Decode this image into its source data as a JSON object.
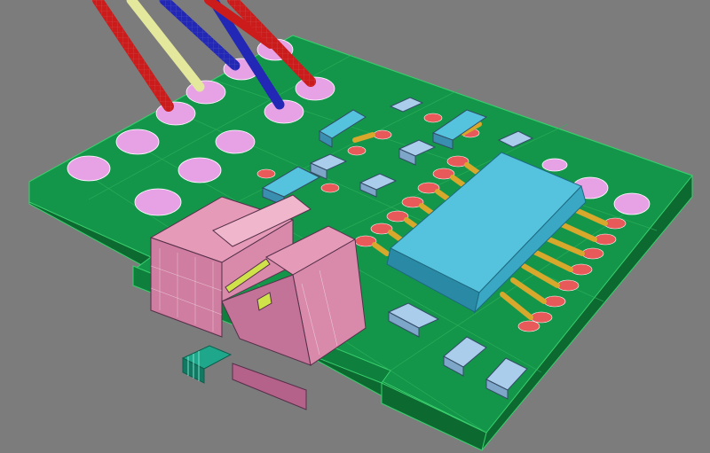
{
  "viewport": {
    "kind": "3D wireframe-on-shaded render of a printed circuit board",
    "background_color": "#7c7c7c"
  },
  "colors": {
    "pcb_top": "#14964a",
    "pcb_side": "#0c6a31",
    "pcb_edge_lines": "#3ad06d",
    "solder_pad": "#e85a5a",
    "ball_pad": "#e7a2e6",
    "lead": "#d7a82b",
    "ic_body": "#55c3de",
    "smd_part": "#a9cdea",
    "connector": "#e59ab7",
    "connector_dark": "#b5628a",
    "connector_pin": "#cfe24a",
    "small_connector": "#1ea78a",
    "wire_red": "#cc1b1b",
    "wire_yellow": "#e4e89c",
    "wire_blue": "#2228b5"
  },
  "wires": [
    {
      "color": "wire_red",
      "name": "wire-red-1"
    },
    {
      "color": "wire_yellow",
      "name": "wire-yellow"
    },
    {
      "color": "wire_blue",
      "name": "wire-blue-1"
    },
    {
      "color": "wire_blue",
      "name": "wire-blue-2"
    },
    {
      "color": "wire_red",
      "name": "wire-red-2"
    }
  ]
}
